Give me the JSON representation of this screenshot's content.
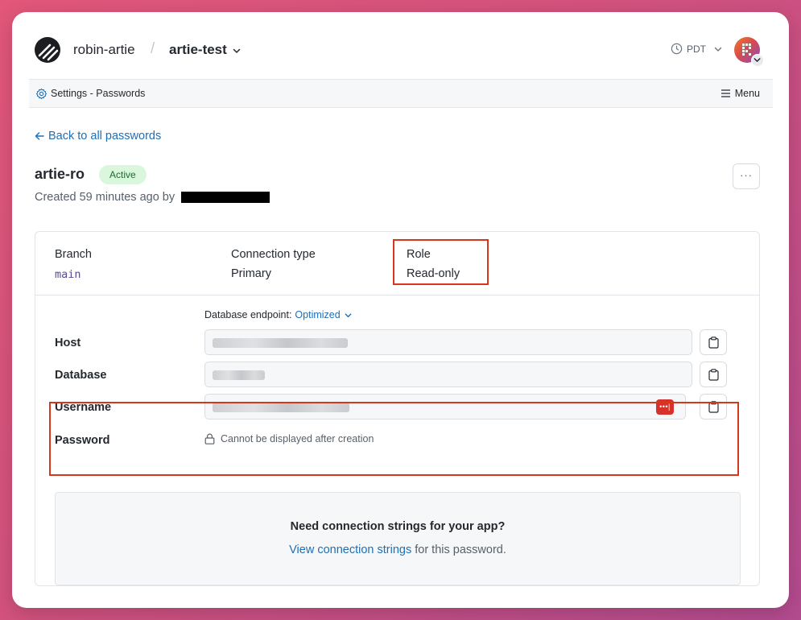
{
  "header": {
    "org_name": "robin-artie",
    "separator": "/",
    "project_name": "artie-test",
    "timezone": "PDT"
  },
  "subbar": {
    "breadcrumb": "Settings - Passwords",
    "menu_label": "Menu"
  },
  "back_link": "Back to all passwords",
  "password": {
    "name": "artie-ro",
    "status": "Active",
    "created_text": "Created 59 minutes ago by",
    "more_label": "···"
  },
  "summary": {
    "branch_label": "Branch",
    "branch_value": "main",
    "connection_type_label": "Connection type",
    "connection_type_value": "Primary",
    "role_label": "Role",
    "role_value": "Read-only"
  },
  "endpoint": {
    "label": "Database endpoint:",
    "value": "Optimized"
  },
  "fields": {
    "host_label": "Host",
    "database_label": "Database",
    "username_label": "Username",
    "password_label": "Password",
    "password_note": "Cannot be displayed after creation",
    "password_manager_icon": "•••|"
  },
  "help": {
    "title": "Need connection strings for your app?",
    "link_text": "View connection strings",
    "suffix_text": " for this password."
  },
  "colors": {
    "link": "#1e6fb5",
    "highlight": "#d8361c",
    "active_badge_bg": "#daf7dd"
  }
}
